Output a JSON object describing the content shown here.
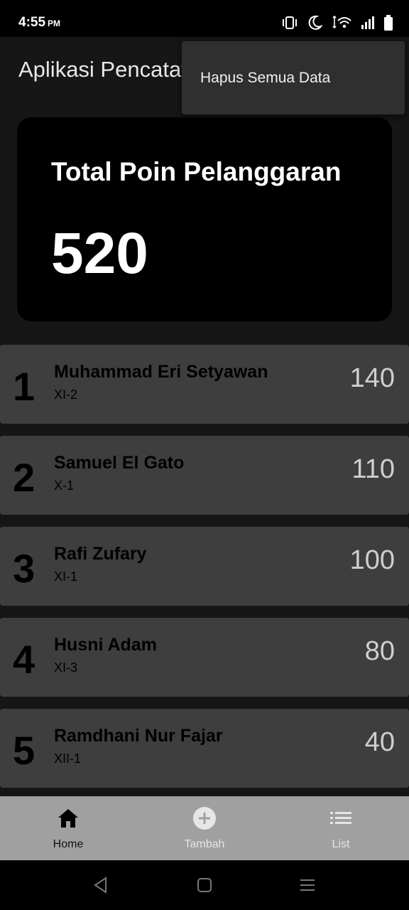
{
  "status_bar": {
    "time": "4:55",
    "ampm": "PM",
    "icons": [
      "vibrate-icon",
      "moon-icon",
      "wifi-icon",
      "signal-icon",
      "battery-icon"
    ]
  },
  "app_bar": {
    "title": "Aplikasi Pencatatan Poin Pelanggaran"
  },
  "menu": {
    "items": [
      {
        "label": "Hapus Semua Data"
      }
    ]
  },
  "summary": {
    "label": "Total Poin Pelanggaran",
    "value": "520"
  },
  "ranking": [
    {
      "rank": "1",
      "name": "Muhammad Eri Setyawan",
      "class": "XI-2",
      "points": "140"
    },
    {
      "rank": "2",
      "name": "Samuel El Gato",
      "class": "X-1",
      "points": "110"
    },
    {
      "rank": "3",
      "name": "Rafi Zufary",
      "class": "XI-1",
      "points": "100"
    },
    {
      "rank": "4",
      "name": "Husni Adam",
      "class": "XI-3",
      "points": "80"
    },
    {
      "rank": "5",
      "name": "Ramdhani Nur Fajar",
      "class": "XII-1",
      "points": "40"
    }
  ],
  "bottom_nav": {
    "items": [
      {
        "label": "Home",
        "icon": "home-icon",
        "active": true
      },
      {
        "label": "Tambah",
        "icon": "add-circle-icon",
        "active": false
      },
      {
        "label": "List",
        "icon": "list-icon",
        "active": false
      }
    ]
  },
  "colors": {
    "background": "#161616",
    "card": "#000000",
    "row": "#3e3e3e",
    "bottom_nav": "#a0a0a0",
    "popup": "#2f2f2f"
  }
}
